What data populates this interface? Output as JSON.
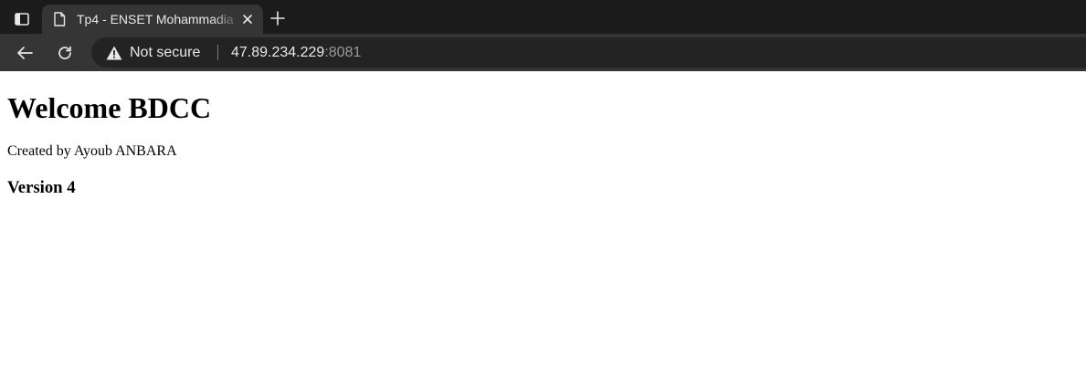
{
  "browser": {
    "tab_title": "Tp4 - ENSET Mohammadia",
    "security_label": "Not secure",
    "url_host": "47.89.234.229",
    "url_port": ":8081",
    "icons": {
      "tab_search": "tab-search-icon",
      "favicon": "page-favicon-icon",
      "tab_close": "close-icon",
      "new_tab": "plus-icon",
      "back": "back-arrow-icon",
      "reload": "reload-icon",
      "security": "warning-icon"
    },
    "colors": {
      "tabstrip_bg": "#1b1b1b",
      "toolbar_bg": "#353535",
      "omnibox_bg": "#232323",
      "text": "#e8e8e8",
      "port_text": "#9a9a9a"
    }
  },
  "page": {
    "heading": "Welcome BDCC",
    "credit": "Created by Ayoub ANBARA",
    "version": "Version 4"
  }
}
